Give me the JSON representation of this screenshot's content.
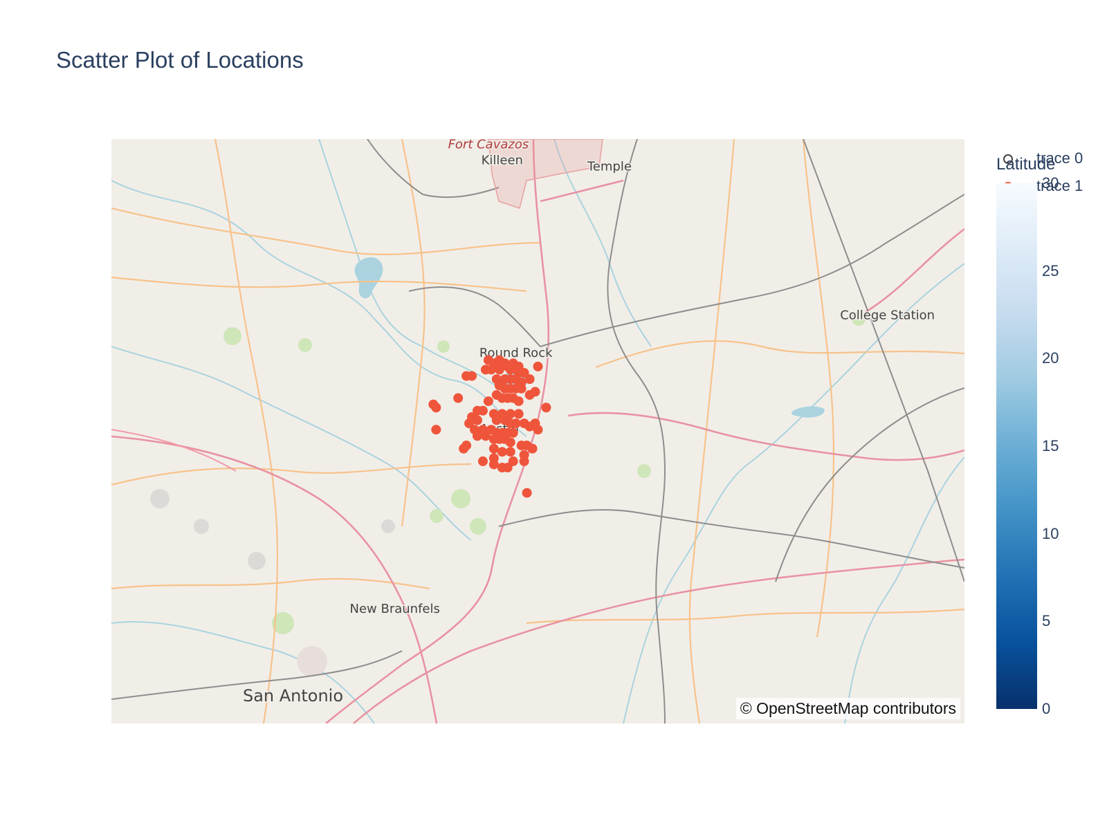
{
  "title": "Scatter Plot of Locations",
  "map": {
    "attribution": "© OpenStreetMap contributors",
    "place_labels": [
      {
        "name": "Fort Cavazos",
        "lon": -97.78,
        "lat": 31.17,
        "style": "military"
      },
      {
        "name": "Killeen",
        "lon": -97.73,
        "lat": 31.12
      },
      {
        "name": "Temple",
        "lon": -97.34,
        "lat": 31.1
      },
      {
        "name": "College Station",
        "lon": -96.33,
        "lat": 30.63
      },
      {
        "name": "Round Rock",
        "lon": -97.68,
        "lat": 30.51
      },
      {
        "name": "Austin",
        "lon": -97.74,
        "lat": 30.27
      },
      {
        "name": "New Braunfels",
        "lon": -98.12,
        "lat": 29.7
      },
      {
        "name": "San Antonio",
        "lon": -98.49,
        "lat": 29.42
      }
    ],
    "extent": {
      "lon": [
        -99.15,
        -96.05
      ],
      "lat": [
        29.35,
        31.2
      ]
    },
    "colors": {
      "land": "#f1eee8",
      "road_major": "#e892a2",
      "road_minor": "#f7c28a",
      "rail": "#8d8d8d",
      "water": "#aad3df",
      "forest": "#bfe0a8"
    }
  },
  "legend": {
    "items": [
      {
        "label": "trace 0",
        "marker": "open-circle",
        "color": "#444444"
      },
      {
        "label": "trace 1",
        "marker": "filled-circle",
        "color": "#ef553b"
      }
    ]
  },
  "colorbar": {
    "title": "Latitude",
    "ticks": [
      "0",
      "5",
      "10",
      "15",
      "20",
      "25",
      "30"
    ],
    "range": [
      0,
      30
    ],
    "colorscale": "Blues (reversed)"
  },
  "chart_data": {
    "type": "scatter",
    "title": "Scatter Plot of Locations",
    "series": [
      {
        "name": "trace 0",
        "points": []
      },
      {
        "name": "trace 1",
        "color": "#ef553b",
        "points": [
          [
            -97.78,
            30.5
          ],
          [
            -97.76,
            30.49
          ],
          [
            -97.74,
            30.5
          ],
          [
            -97.72,
            30.49
          ],
          [
            -97.71,
            30.48
          ],
          [
            -97.69,
            30.49
          ],
          [
            -97.67,
            30.48
          ],
          [
            -97.79,
            30.47
          ],
          [
            -97.77,
            30.47
          ],
          [
            -97.74,
            30.47
          ],
          [
            -97.7,
            30.47
          ],
          [
            -97.67,
            30.46
          ],
          [
            -97.65,
            30.46
          ],
          [
            -97.6,
            30.48
          ],
          [
            -97.63,
            30.44
          ],
          [
            -97.75,
            30.44
          ],
          [
            -97.72,
            30.44
          ],
          [
            -97.7,
            30.44
          ],
          [
            -97.68,
            30.44
          ],
          [
            -97.66,
            30.43
          ],
          [
            -97.86,
            30.45
          ],
          [
            -97.84,
            30.45
          ],
          [
            -97.74,
            30.42
          ],
          [
            -97.72,
            30.41
          ],
          [
            -97.7,
            30.41
          ],
          [
            -97.68,
            30.41
          ],
          [
            -97.66,
            30.41
          ],
          [
            -97.61,
            30.4
          ],
          [
            -97.63,
            30.39
          ],
          [
            -97.75,
            30.39
          ],
          [
            -97.73,
            30.38
          ],
          [
            -97.71,
            30.38
          ],
          [
            -97.69,
            30.38
          ],
          [
            -97.67,
            30.37
          ],
          [
            -97.89,
            30.38
          ],
          [
            -97.78,
            30.37
          ],
          [
            -97.98,
            30.36
          ],
          [
            -97.97,
            30.35
          ],
          [
            -97.57,
            30.35
          ],
          [
            -97.82,
            30.34
          ],
          [
            -97.8,
            30.34
          ],
          [
            -97.76,
            30.33
          ],
          [
            -97.73,
            30.33
          ],
          [
            -97.7,
            30.33
          ],
          [
            -97.67,
            30.33
          ],
          [
            -97.84,
            30.32
          ],
          [
            -97.82,
            30.31
          ],
          [
            -97.85,
            30.3
          ],
          [
            -97.75,
            30.31
          ],
          [
            -97.72,
            30.31
          ],
          [
            -97.7,
            30.3
          ],
          [
            -97.68,
            30.3
          ],
          [
            -97.65,
            30.3
          ],
          [
            -97.63,
            30.29
          ],
          [
            -97.61,
            30.3
          ],
          [
            -97.97,
            30.28
          ],
          [
            -97.6,
            30.28
          ],
          [
            -97.83,
            30.28
          ],
          [
            -97.8,
            30.28
          ],
          [
            -97.77,
            30.28
          ],
          [
            -97.75,
            30.27
          ],
          [
            -97.73,
            30.27
          ],
          [
            -97.71,
            30.27
          ],
          [
            -97.69,
            30.27
          ],
          [
            -97.82,
            30.26
          ],
          [
            -97.79,
            30.26
          ],
          [
            -97.76,
            30.25
          ],
          [
            -97.74,
            30.25
          ],
          [
            -97.72,
            30.25
          ],
          [
            -97.7,
            30.24
          ],
          [
            -97.86,
            30.23
          ],
          [
            -97.66,
            30.23
          ],
          [
            -97.64,
            30.23
          ],
          [
            -97.62,
            30.22
          ],
          [
            -97.87,
            30.22
          ],
          [
            -97.76,
            30.22
          ],
          [
            -97.73,
            30.21
          ],
          [
            -97.7,
            30.21
          ],
          [
            -97.65,
            30.2
          ],
          [
            -97.76,
            30.19
          ],
          [
            -97.8,
            30.18
          ],
          [
            -97.69,
            30.18
          ],
          [
            -97.65,
            30.18
          ],
          [
            -97.76,
            30.17
          ],
          [
            -97.73,
            30.16
          ],
          [
            -97.71,
            30.16
          ],
          [
            -97.64,
            30.08
          ]
        ]
      }
    ],
    "marker_color_variable": "Latitude",
    "colorbar_range": [
      0,
      30
    ]
  }
}
